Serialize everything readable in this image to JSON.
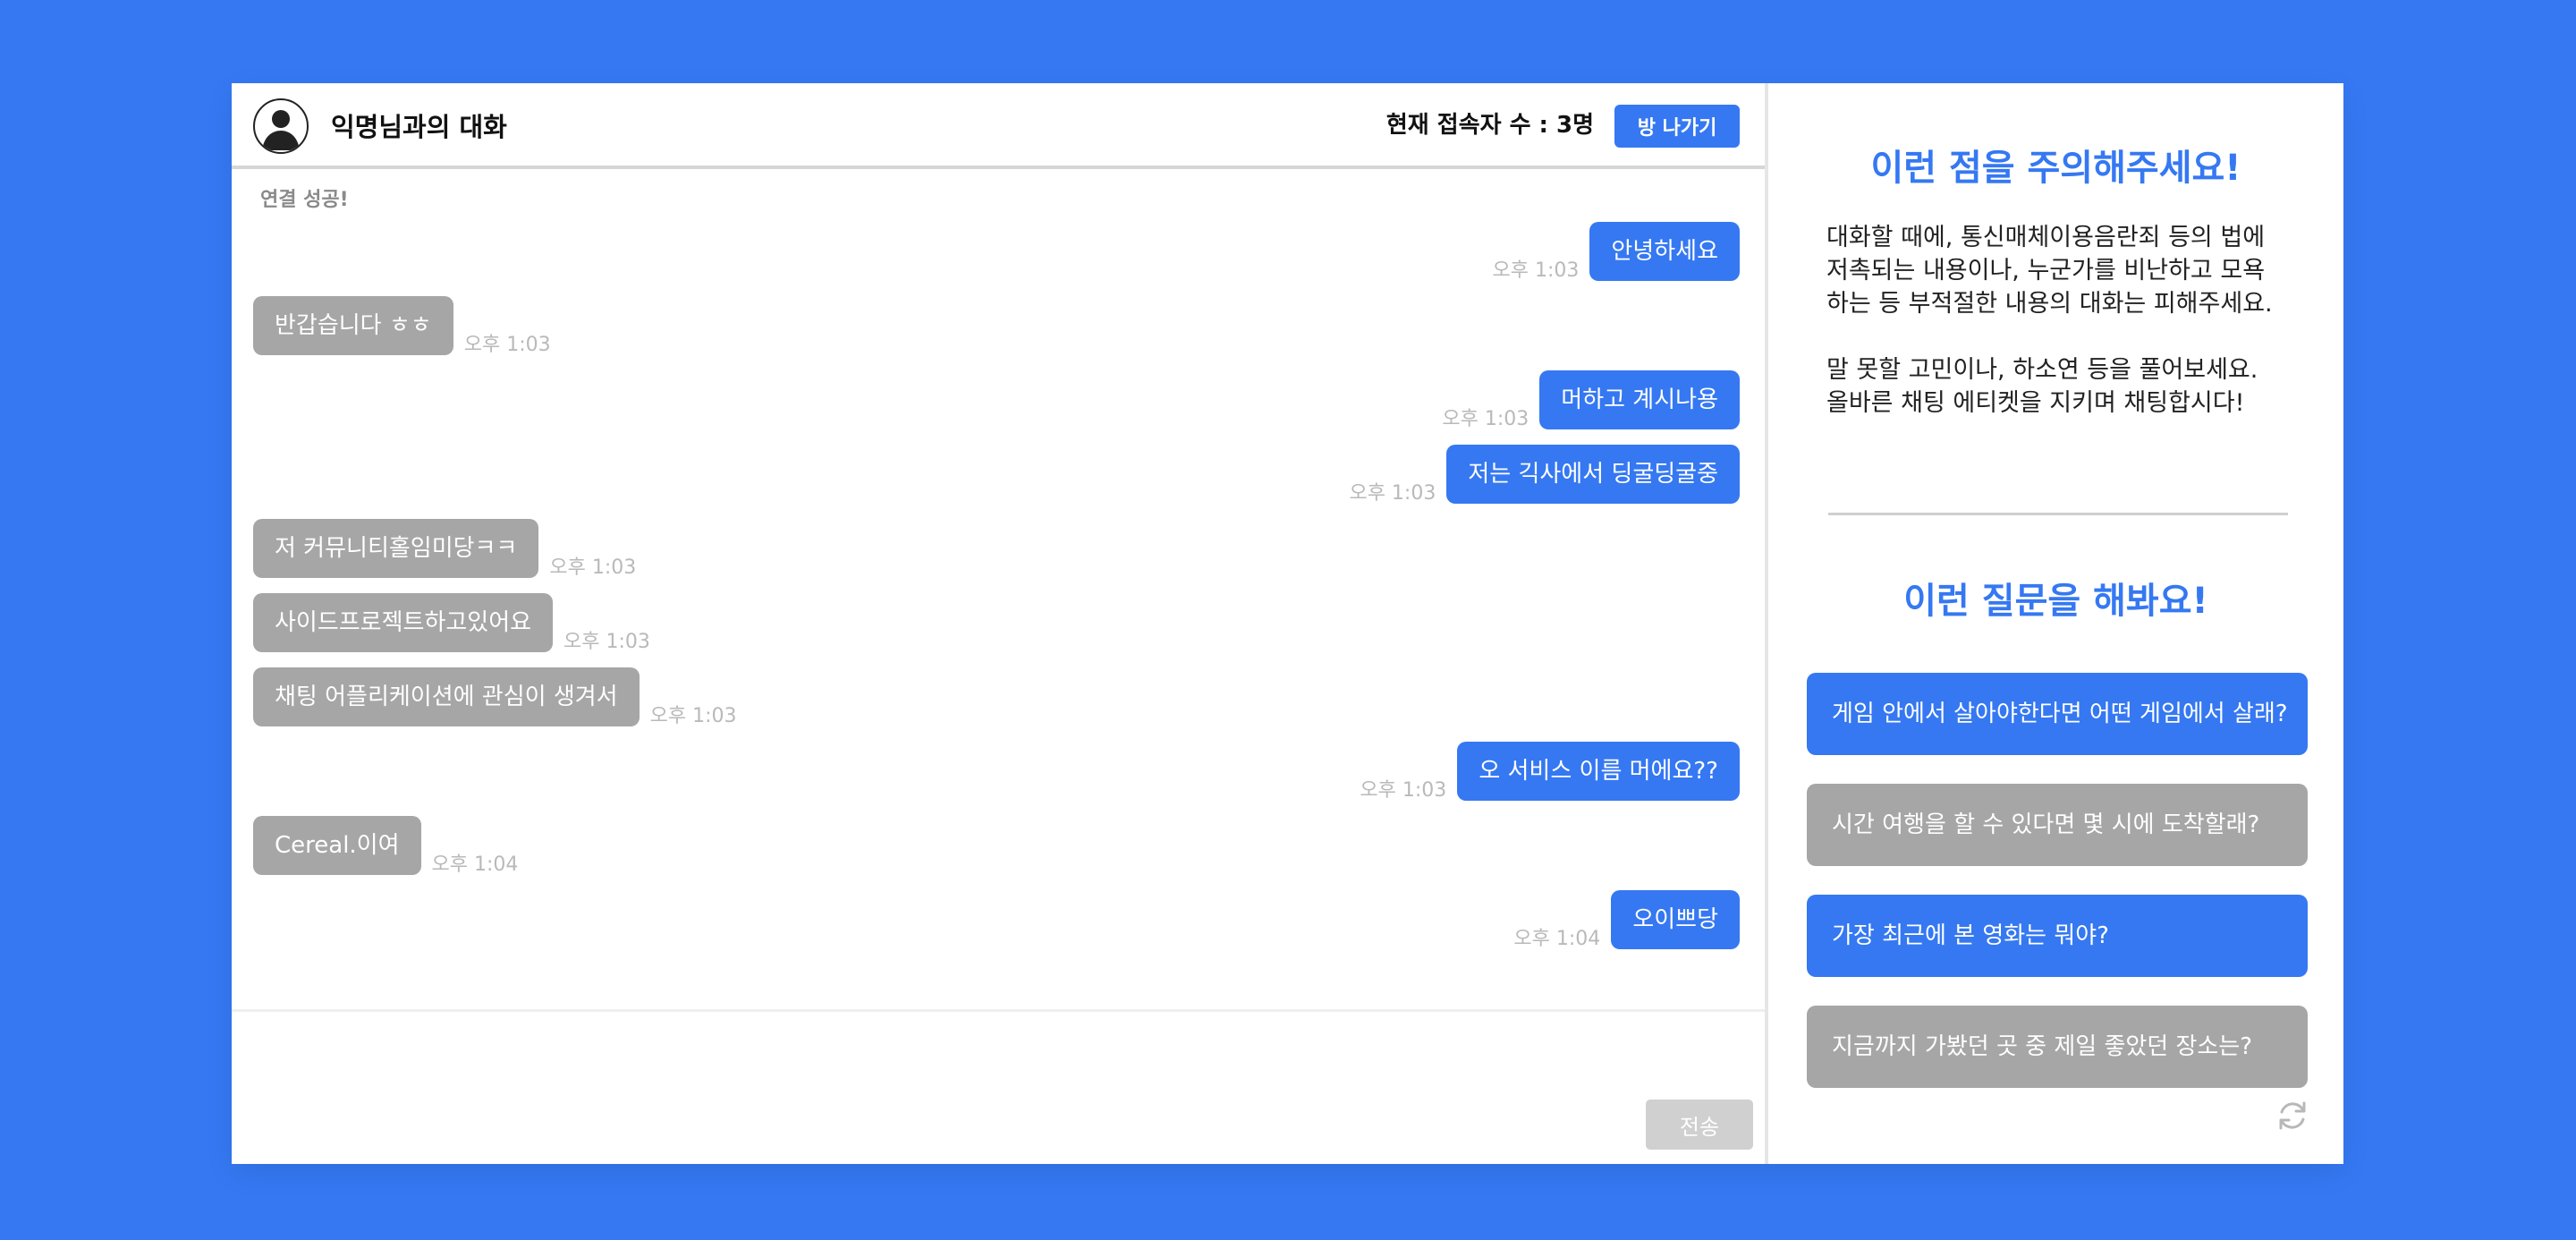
{
  "chat": {
    "title": "익명님과의 대화",
    "user_count": "현재 접속자 수 : 3명",
    "leave_label": "방 나가기",
    "system_message": "연결 성공!",
    "messages": [
      {
        "side": "me",
        "text": "안녕하세요",
        "time": "오후 1:03"
      },
      {
        "side": "other",
        "text": "반갑습니다 ㅎㅎ",
        "time": "오후 1:03"
      },
      {
        "side": "me",
        "text": "머하고 계시나용",
        "time": "오후 1:03"
      },
      {
        "side": "me",
        "text": "저는 긱사에서 딩굴딩굴중",
        "time": "오후 1:03"
      },
      {
        "side": "other",
        "text": "저 커뮤니티홀임미당ㅋㅋ",
        "time": "오후 1:03"
      },
      {
        "side": "other",
        "text": "사이드프로젝트하고있어요",
        "time": "오후 1:03"
      },
      {
        "side": "other",
        "text": "채팅 어플리케이션에 관심이 생겨서",
        "time": "오후 1:03"
      },
      {
        "side": "me",
        "text": "오 서비스 이름 머에요??",
        "time": "오후 1:03"
      },
      {
        "side": "other",
        "text": "Cereal.이여",
        "time": "오후 1:04"
      },
      {
        "side": "me",
        "text": "오이쁘당",
        "time": "오후 1:04"
      }
    ],
    "input_value": "",
    "send_label": "전송"
  },
  "side": {
    "notice_title": "이런 점을 주의해주세요!",
    "notice_p1_line1": "대화할 때에, 통신매체이용음란죄 등의 법에",
    "notice_p1_line2": "저촉되는 내용이나, 누군가를 비난하고 모욕",
    "notice_p1_line3": "하는 등 부적절한 내용의 대화는 피해주세요.",
    "notice_p2_line1": "말 못할 고민이나, 하소연 등을 풀어보세요.",
    "notice_p2_line2": "올바른 채팅 에티켓을 지키며 채팅합시다!",
    "questions_title": "이런 질문을 해봐요!",
    "questions": [
      {
        "text": "게임 안에서 살아야한다면 어떤 게임에서 살래?",
        "style": "blue"
      },
      {
        "text": "시간 여행을 할 수 있다면 몇 시에 도착할래?",
        "style": "gray"
      },
      {
        "text": "가장 최근에 본 영화는 뭐야?",
        "style": "blue"
      },
      {
        "text": "지금까지 가봤던 곳 중 제일 좋았던 장소는?",
        "style": "gray"
      }
    ],
    "refresh_icon": "refresh-icon"
  },
  "colors": {
    "accent": "#3578F2",
    "other_bubble": "#A6A6A6",
    "send_disabled": "#D0D0D0"
  }
}
